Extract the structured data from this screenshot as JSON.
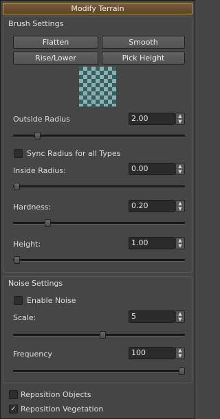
{
  "panel": {
    "title": "Modify Terrain"
  },
  "brush": {
    "section_title": "Brush Settings",
    "buttons": {
      "flatten": "Flatten",
      "smooth": "Smooth",
      "rise_lower": "Rise/Lower",
      "pick_height": "Pick Height"
    },
    "outside_radius": {
      "label": "Outside Radius",
      "value": "2.00",
      "slider_fraction": 0.14
    },
    "sync_radius": {
      "label": "Sync Radius for all Types",
      "checked": false
    },
    "inside_radius": {
      "label": "Inside Radius:",
      "value": "0.00",
      "slider_fraction": 0.02
    },
    "hardness": {
      "label": "Hardness:",
      "value": "0.20",
      "slider_fraction": 0.2
    },
    "height": {
      "label": "Height:",
      "value": "1.00",
      "slider_fraction": 0.02
    }
  },
  "noise": {
    "section_title": "Noise Settings",
    "enable_noise": {
      "label": "Enable Noise",
      "checked": false
    },
    "scale": {
      "label": "Scale:",
      "value": "5",
      "slider_fraction": 0.52
    },
    "frequency": {
      "label": "Frequency",
      "value": "100",
      "slider_fraction": 0.98
    }
  },
  "options": {
    "reposition_objects": {
      "label": "Reposition Objects",
      "checked": false
    },
    "reposition_vegetation": {
      "label": "Reposition Vegetation",
      "checked": true,
      "check_glyph": "✓"
    }
  },
  "icons": {
    "spin_up": "▲",
    "spin_down": "▼"
  },
  "colors": {
    "title_bar": "#6b4e32",
    "title_border": "#c79b66",
    "background": "#454545",
    "field": "#2b2b2b"
  }
}
